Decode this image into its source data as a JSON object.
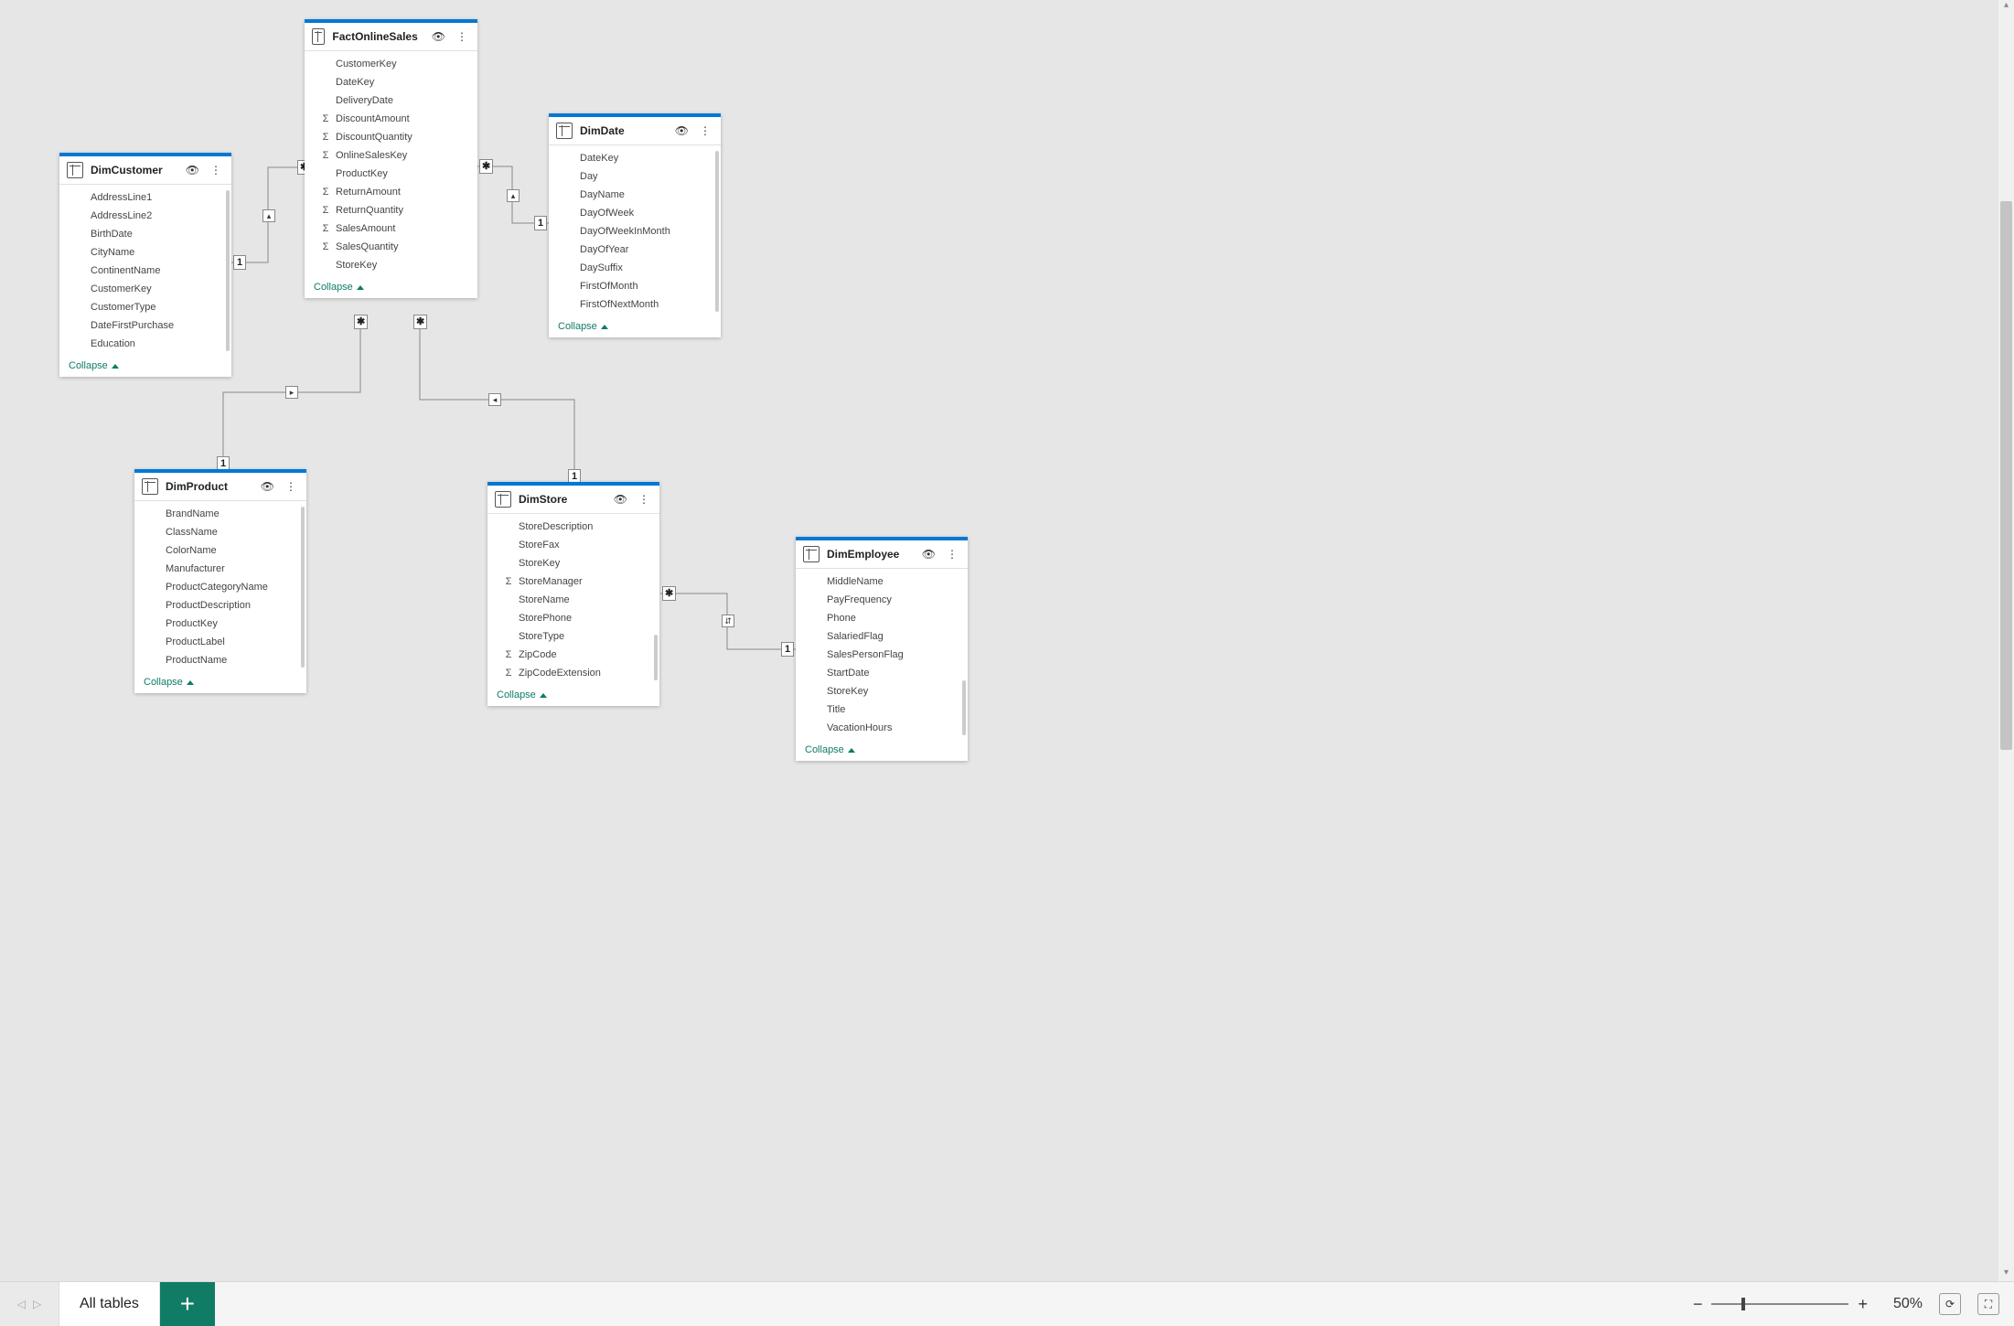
{
  "collapse_label": "Collapse",
  "zoom_text": "50%",
  "active_tab": "All tables",
  "tables": {
    "dimcustomer": {
      "title": "DimCustomer",
      "fields": [
        {
          "name": "AddressLine1"
        },
        {
          "name": "AddressLine2"
        },
        {
          "name": "BirthDate"
        },
        {
          "name": "CityName"
        },
        {
          "name": "ContinentName"
        },
        {
          "name": "CustomerKey"
        },
        {
          "name": "CustomerType"
        },
        {
          "name": "DateFirstPurchase"
        },
        {
          "name": "Education"
        }
      ]
    },
    "factonlinesales": {
      "title": "FactOnlineSales",
      "fields": [
        {
          "name": "CustomerKey"
        },
        {
          "name": "DateKey"
        },
        {
          "name": "DeliveryDate"
        },
        {
          "name": "DiscountAmount",
          "agg": true
        },
        {
          "name": "DiscountQuantity",
          "agg": true
        },
        {
          "name": "OnlineSalesKey",
          "agg": true
        },
        {
          "name": "ProductKey"
        },
        {
          "name": "ReturnAmount",
          "agg": true
        },
        {
          "name": "ReturnQuantity",
          "agg": true
        },
        {
          "name": "SalesAmount",
          "agg": true
        },
        {
          "name": "SalesQuantity",
          "agg": true
        },
        {
          "name": "StoreKey"
        }
      ]
    },
    "dimdate": {
      "title": "DimDate",
      "fields": [
        {
          "name": "DateKey"
        },
        {
          "name": "Day"
        },
        {
          "name": "DayName"
        },
        {
          "name": "DayOfWeek"
        },
        {
          "name": "DayOfWeekInMonth"
        },
        {
          "name": "DayOfYear"
        },
        {
          "name": "DaySuffix"
        },
        {
          "name": "FirstOfMonth"
        },
        {
          "name": "FirstOfNextMonth"
        }
      ]
    },
    "dimproduct": {
      "title": "DimProduct",
      "fields": [
        {
          "name": "BrandName"
        },
        {
          "name": "ClassName"
        },
        {
          "name": "ColorName"
        },
        {
          "name": "Manufacturer"
        },
        {
          "name": "ProductCategoryName"
        },
        {
          "name": "ProductDescription"
        },
        {
          "name": "ProductKey"
        },
        {
          "name": "ProductLabel"
        },
        {
          "name": "ProductName"
        }
      ]
    },
    "dimstore": {
      "title": "DimStore",
      "fields": [
        {
          "name": "StoreDescription"
        },
        {
          "name": "StoreFax"
        },
        {
          "name": "StoreKey"
        },
        {
          "name": "StoreManager",
          "agg": true
        },
        {
          "name": "StoreName"
        },
        {
          "name": "StorePhone"
        },
        {
          "name": "StoreType"
        },
        {
          "name": "ZipCode",
          "agg": true
        },
        {
          "name": "ZipCodeExtension",
          "agg": true
        }
      ]
    },
    "dimemployee": {
      "title": "DimEmployee",
      "fields": [
        {
          "name": "MiddleName"
        },
        {
          "name": "PayFrequency"
        },
        {
          "name": "Phone"
        },
        {
          "name": "SalariedFlag"
        },
        {
          "name": "SalesPersonFlag"
        },
        {
          "name": "StartDate"
        },
        {
          "name": "StoreKey"
        },
        {
          "name": "Title"
        },
        {
          "name": "VacationHours"
        }
      ]
    }
  }
}
